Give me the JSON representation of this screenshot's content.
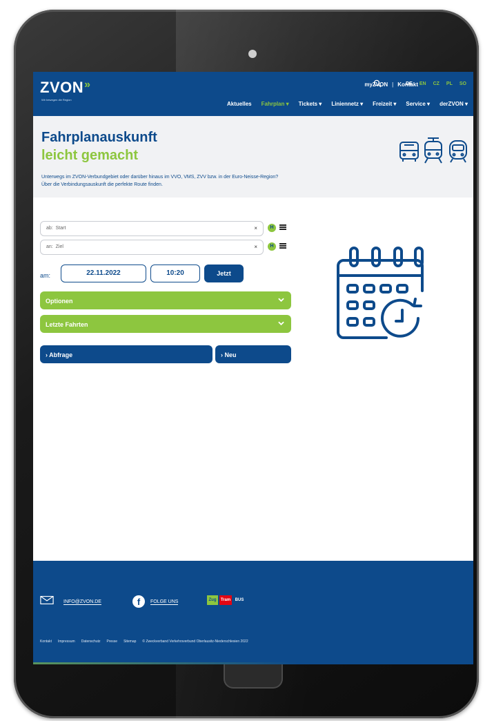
{
  "header": {
    "logo_text": "ZVON",
    "logo_arrows": "»",
    "tagline": "Wir bewegen die Region",
    "top_links": [
      "myZVON",
      "Kontakt"
    ],
    "separator": "|",
    "languages": [
      "DE",
      "EN",
      "CZ",
      "PL",
      "SO"
    ],
    "active_language": "DE",
    "nav": [
      "Aktuelles",
      "Fahrplan ▾",
      "Tickets ▾",
      "Liniennetz ▾",
      "Freizeit ▾",
      "Service ▾",
      "derZVON ▾"
    ],
    "active_nav": "Fahrplan ▾"
  },
  "hero": {
    "title_line1": "Fahrplanauskunft",
    "title_line2": "leicht gemacht",
    "intro_line1": "Unterwegs im ZVON-Verbundgebiet oder darüber hinaus im VVO, VMS, ZVV bzw. in der Euro-Neisse-Region?",
    "intro_line2": "Über die Verbindungsauskunft die perfekte Route finden.",
    "mode_icons": [
      "bus-icon",
      "tram-icon",
      "train-icon"
    ]
  },
  "form": {
    "from_label": "ab:",
    "from_placeholder": "Start",
    "to_label": "an:",
    "to_placeholder": "Ziel",
    "clear_glyph": "×",
    "stop_glyph": "H",
    "date_label": "am:",
    "date_value": "22.11.2022",
    "time_value": "10:20",
    "now_button": "Jetzt",
    "options_label": "Optionen",
    "recent_label": "Letzte Fahrten",
    "query_button": "› Abfrage",
    "new_button": "› Neu"
  },
  "footer": {
    "email": "INFO@ZVON.DE",
    "social": "FOLGE UNS",
    "badges": [
      "Zug",
      "Tram",
      "BUS"
    ],
    "links": [
      "Kontakt",
      "Impressum",
      "Datenschutz",
      "Presse",
      "Sitemap",
      "© Zweckverband Verkehrsverbund Oberlausitz-Niederschlesien 2022"
    ]
  },
  "colors": {
    "brand_blue": "#0d4a8b",
    "brand_green": "#8dc63f",
    "tram_red": "#e30613"
  }
}
